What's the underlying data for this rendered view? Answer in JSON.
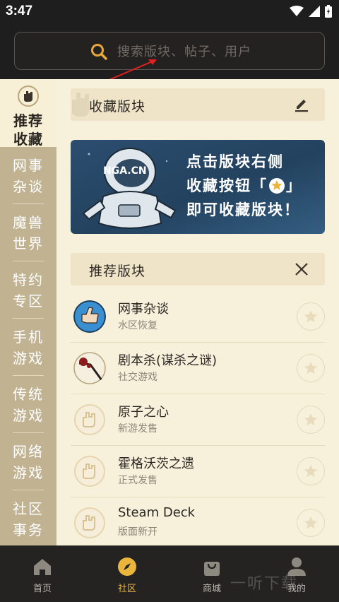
{
  "status": {
    "time": "3:47"
  },
  "search": {
    "placeholder": "搜索版块、帖子、用户"
  },
  "sidebar": {
    "active_label": "推荐收藏",
    "items": [
      {
        "label": "网事杂谈"
      },
      {
        "label": "魔兽世界"
      },
      {
        "label": "特约专区"
      },
      {
        "label": "手机游戏"
      },
      {
        "label": "传统游戏"
      },
      {
        "label": "网络游戏"
      },
      {
        "label": "社区事务"
      }
    ]
  },
  "favorites": {
    "title": "收藏版块"
  },
  "banner": {
    "logo_text": "NGA.CN",
    "line1": "点击版块右侧",
    "line2": "收藏按钮「",
    "line2_end": "」",
    "line3": "即可收藏版块！"
  },
  "recommended": {
    "title": "推荐版块",
    "rows": [
      {
        "name": "网事杂谈",
        "sub": "水区恢复"
      },
      {
        "name": "剧本杀(谋杀之谜)",
        "sub": "社交游戏"
      },
      {
        "name": "原子之心",
        "sub": "新游发售"
      },
      {
        "name": "霍格沃茨之遗",
        "sub": "正式发售"
      },
      {
        "name": "Steam Deck",
        "sub": "版面新开"
      }
    ]
  },
  "tabs": [
    {
      "label": "首页"
    },
    {
      "label": "社区"
    },
    {
      "label": "商城"
    },
    {
      "label": "我的"
    }
  ],
  "watermark": "一听下载",
  "colors": {
    "accent": "#e9b53c",
    "sidebar": "#c1b292",
    "content_bg": "#f7f1dc"
  }
}
